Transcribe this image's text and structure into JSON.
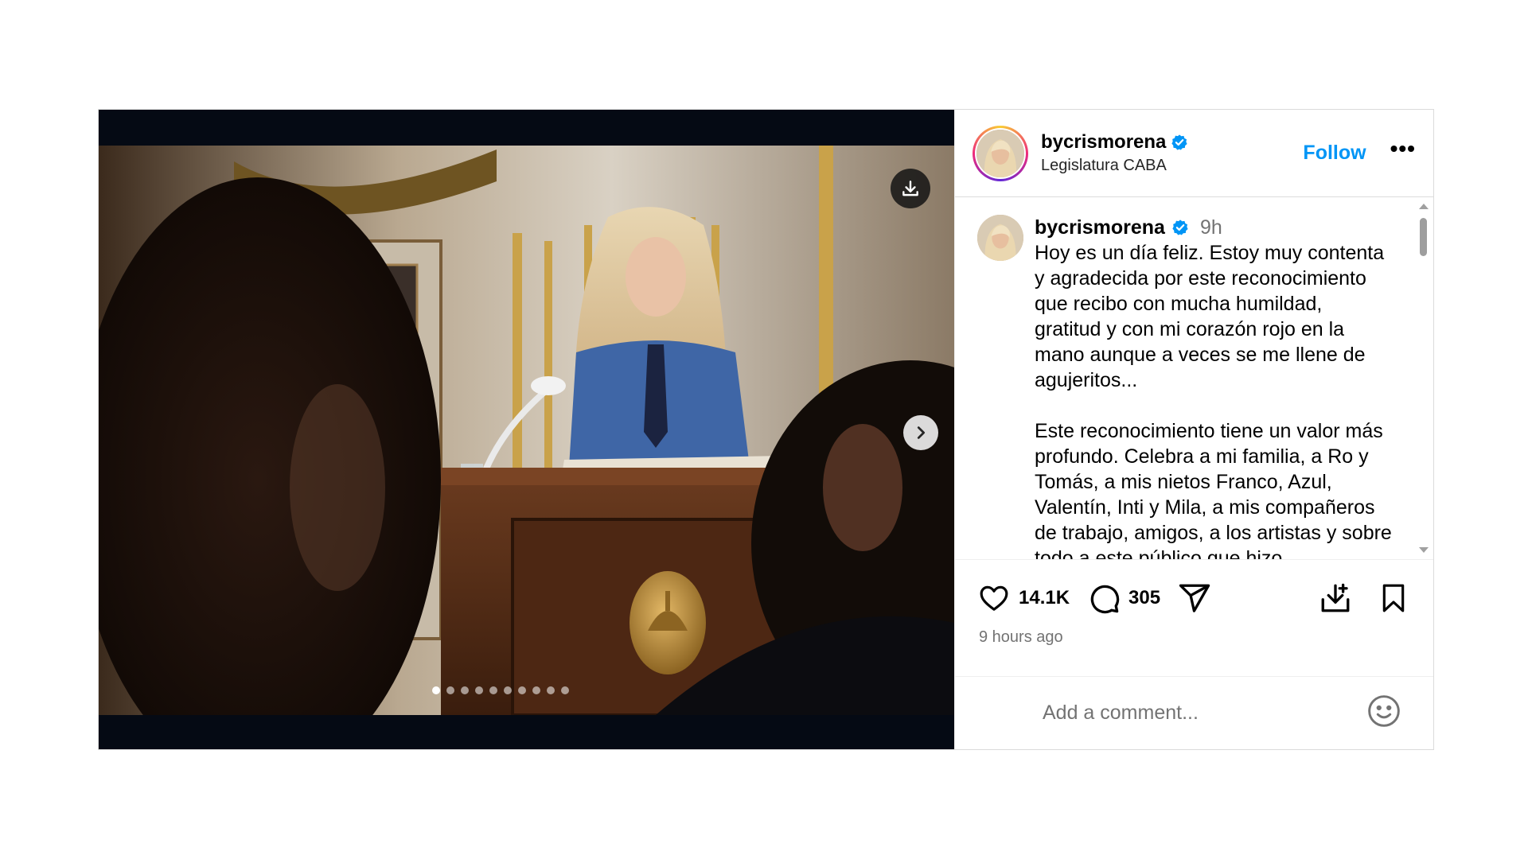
{
  "post": {
    "carousel": {
      "slide_count": 10,
      "active_index": 0
    },
    "header": {
      "username": "bycrismorena",
      "location": "Legislatura CABA",
      "follow_label": "Follow",
      "more_label": "•••"
    },
    "caption": {
      "username": "bycrismorena",
      "time_ago": "9h",
      "text": "Hoy es un día feliz. Estoy muy contenta\ny agradecida por este reconocimiento\nque recibo con mucha humildad,\ngratitud y con mi corazón rojo en la\nmano aunque a veces se me llene de\nagujeritos...\n\nEste reconocimiento tiene un valor más\nprofundo. Celebra a mi familia, a Ro y\nTomás, a mis nietos Franco, Azul,\nValentín, Inti y Mila, a mis compañeros\nde trabajo, amigos, a los artistas y sobre\ntodo a este público que hizo..."
    },
    "actions": {
      "likes": "14.1K",
      "comments": "305"
    },
    "timestamp": "9 hours ago",
    "comment_placeholder": "Add a comment...",
    "colors": {
      "follow_blue": "#0095f6",
      "verified_blue": "#0095f6",
      "muted_text": "#737373"
    },
    "icons": [
      "download-icon",
      "chevron-right-icon",
      "verified-badge-icon",
      "more-icon",
      "heart-icon",
      "comment-icon",
      "share-icon",
      "save-to-device-icon",
      "bookmark-icon",
      "emoji-icon"
    ]
  }
}
